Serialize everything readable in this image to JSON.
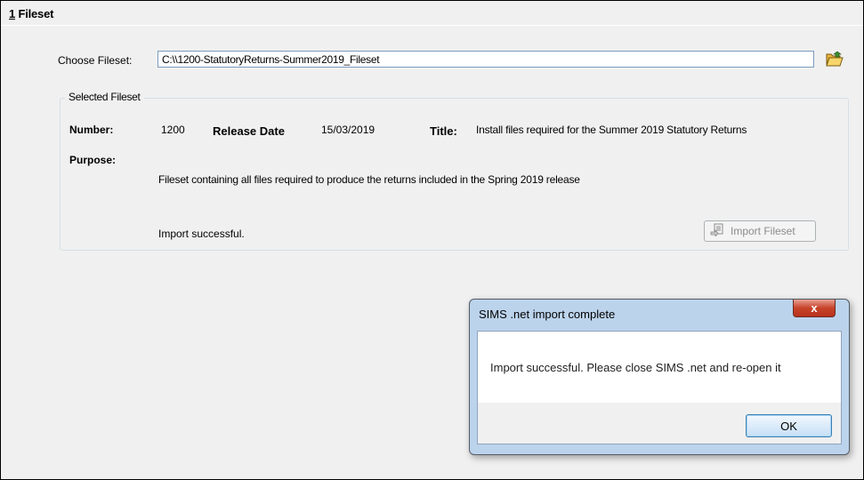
{
  "section": {
    "number": "1",
    "title": "Fileset"
  },
  "choose_fileset": {
    "label": "Choose Fileset:",
    "value": "C:\\\\1200-StatutoryReturns-Summer2019_Fileset"
  },
  "icons": {
    "browse": "open-folder-icon",
    "import": "import-fileset-icon"
  },
  "selected_fileset": {
    "group_title": "Selected Fileset",
    "number_label": "Number:",
    "number_value": "1200",
    "release_date_label": "Release Date",
    "release_date_value": "15/03/2019",
    "title_label": "Title:",
    "title_value": "Install files required for the Summer 2019 Statutory Returns",
    "purpose_label": "Purpose:",
    "purpose_value": "Fileset containing all files required to produce the returns included in the Spring 2019 release",
    "status": "Import successful.",
    "import_button": "Import Fileset"
  },
  "dialog": {
    "title": "SIMS .net import complete",
    "close_glyph": "x",
    "message": "Import successful. Please close SIMS .net and re-open it",
    "ok_label": "OK"
  },
  "colors": {
    "dialog_frame": "#bcd3ec",
    "close_button": "#c7432a",
    "disabled_text": "#8b8b8b"
  }
}
